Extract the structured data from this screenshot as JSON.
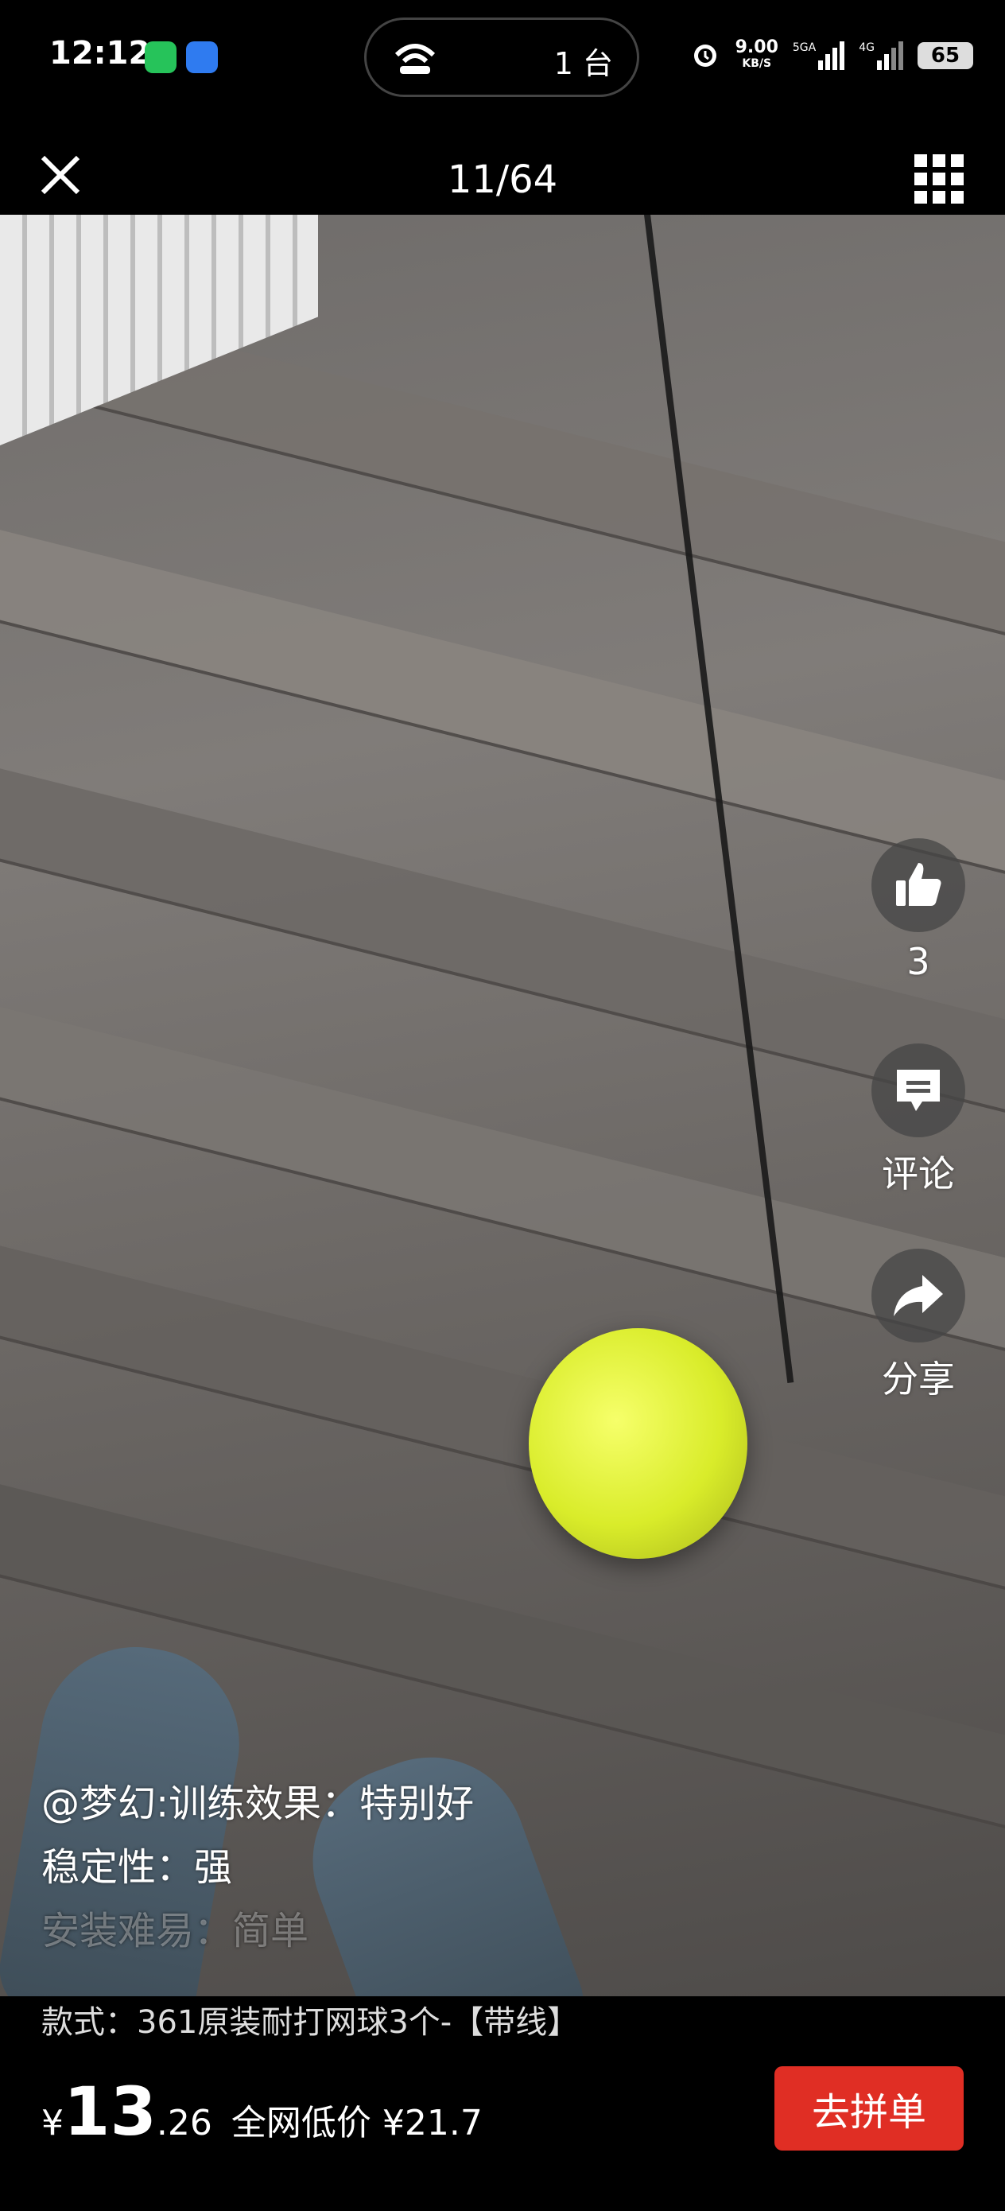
{
  "status_bar": {
    "time": "12:12",
    "pill_count": "1 台",
    "net_speed": "9.00",
    "net_unit": "KB/S",
    "sig1": "5GA",
    "sig2": "4G",
    "battery": "65"
  },
  "header": {
    "counter": "11/64"
  },
  "actions": {
    "like_count": "3",
    "comment_label": "评论",
    "share_label": "分享"
  },
  "review": {
    "line1": "@梦幻:训练效果：特别好",
    "line2": "稳定性：强",
    "line3": "安装难易：简单"
  },
  "product": {
    "style": "款式：361原装耐打网球3个-【带线】",
    "currency": "¥",
    "price_int": "13",
    "price_dec": ".26",
    "low_price": "全网低价 ¥21.7",
    "buy_label": "去拼单"
  },
  "colors": {
    "accent": "#e02e24",
    "background": "#000000"
  }
}
